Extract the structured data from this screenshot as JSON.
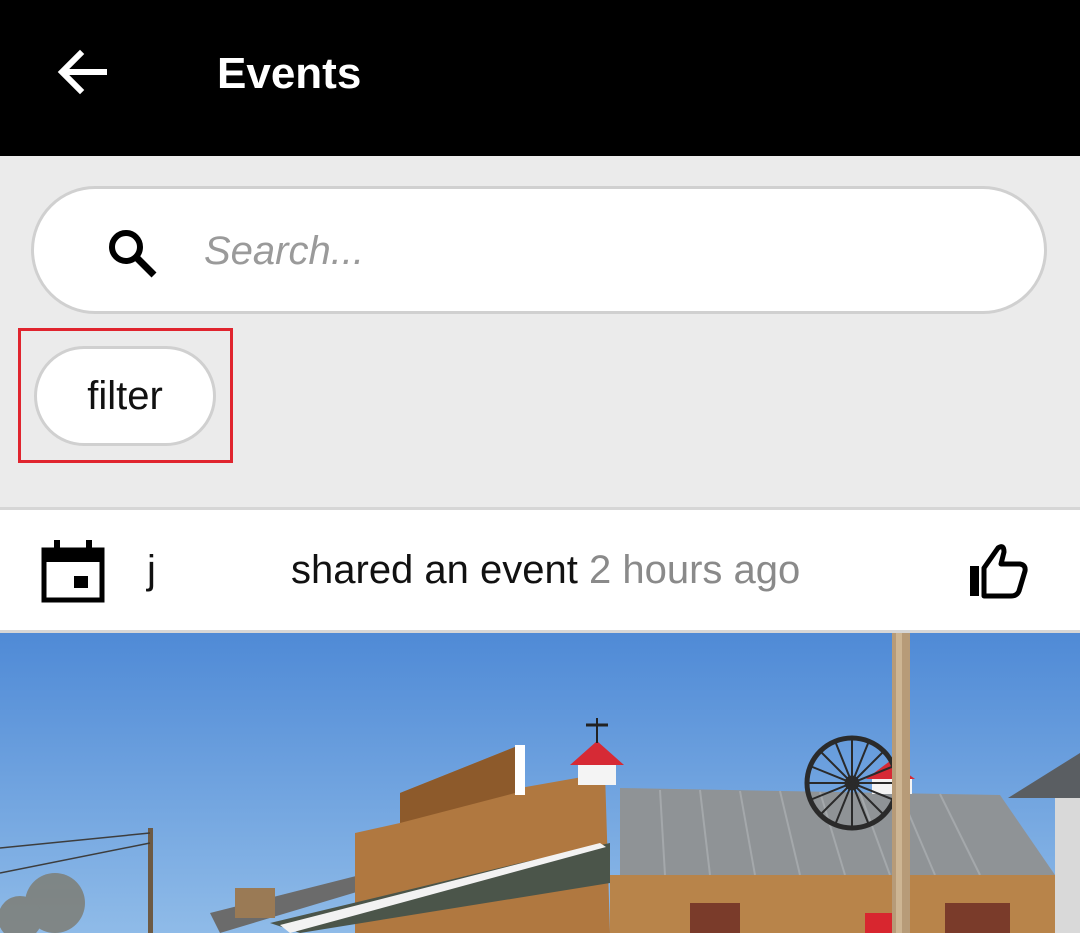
{
  "app_bar": {
    "title": "Events",
    "back_icon": "arrow-left-icon"
  },
  "search": {
    "placeholder": "Search...",
    "value": "",
    "icon": "search-icon"
  },
  "filter": {
    "label": "filter"
  },
  "event": {
    "type_icon": "calendar-icon",
    "user": "j",
    "action": "shared an event",
    "time": "2 hours ago",
    "like_icon": "thumbs-up-icon"
  },
  "colors": {
    "app_bar_bg": "#000000",
    "page_bg": "#ebebeb",
    "highlight": "#e0242e",
    "muted_text": "#8a8a8a"
  }
}
